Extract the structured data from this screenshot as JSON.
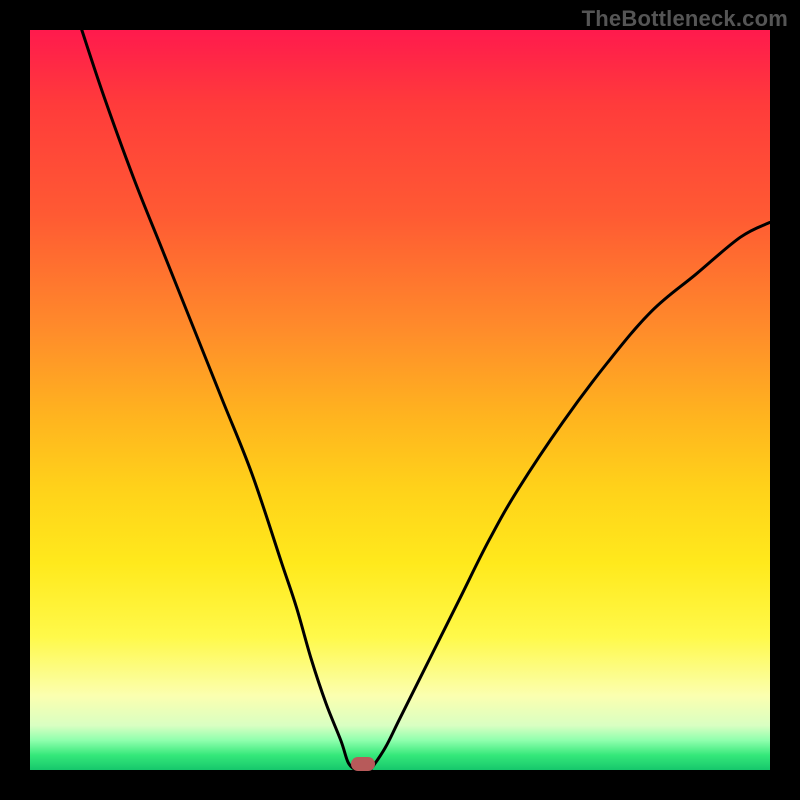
{
  "watermark": "TheBottleneck.com",
  "colors": {
    "frame": "#000000",
    "gradient_top": "#ff1a4d",
    "gradient_bottom": "#16c76c",
    "curve": "#000000",
    "marker": "#b75a5a"
  },
  "chart_data": {
    "type": "line",
    "title": "",
    "xlabel": "",
    "ylabel": "",
    "xlim": [
      0,
      100
    ],
    "ylim": [
      0,
      100
    ],
    "series": [
      {
        "name": "left-branch",
        "x": [
          7,
          10,
          14,
          18,
          22,
          26,
          30,
          34,
          36,
          38,
          40,
          42,
          43,
          44
        ],
        "values": [
          100,
          91,
          80,
          70,
          60,
          50,
          40,
          28,
          22,
          15,
          9,
          4,
          1,
          0
        ]
      },
      {
        "name": "right-branch",
        "x": [
          46,
          48,
          50,
          54,
          58,
          62,
          66,
          72,
          78,
          84,
          90,
          96,
          100
        ],
        "values": [
          0,
          3,
          7,
          15,
          23,
          31,
          38,
          47,
          55,
          62,
          67,
          72,
          74
        ]
      }
    ],
    "annotations": [
      {
        "name": "min-marker",
        "x": 45,
        "y": 0
      }
    ]
  }
}
